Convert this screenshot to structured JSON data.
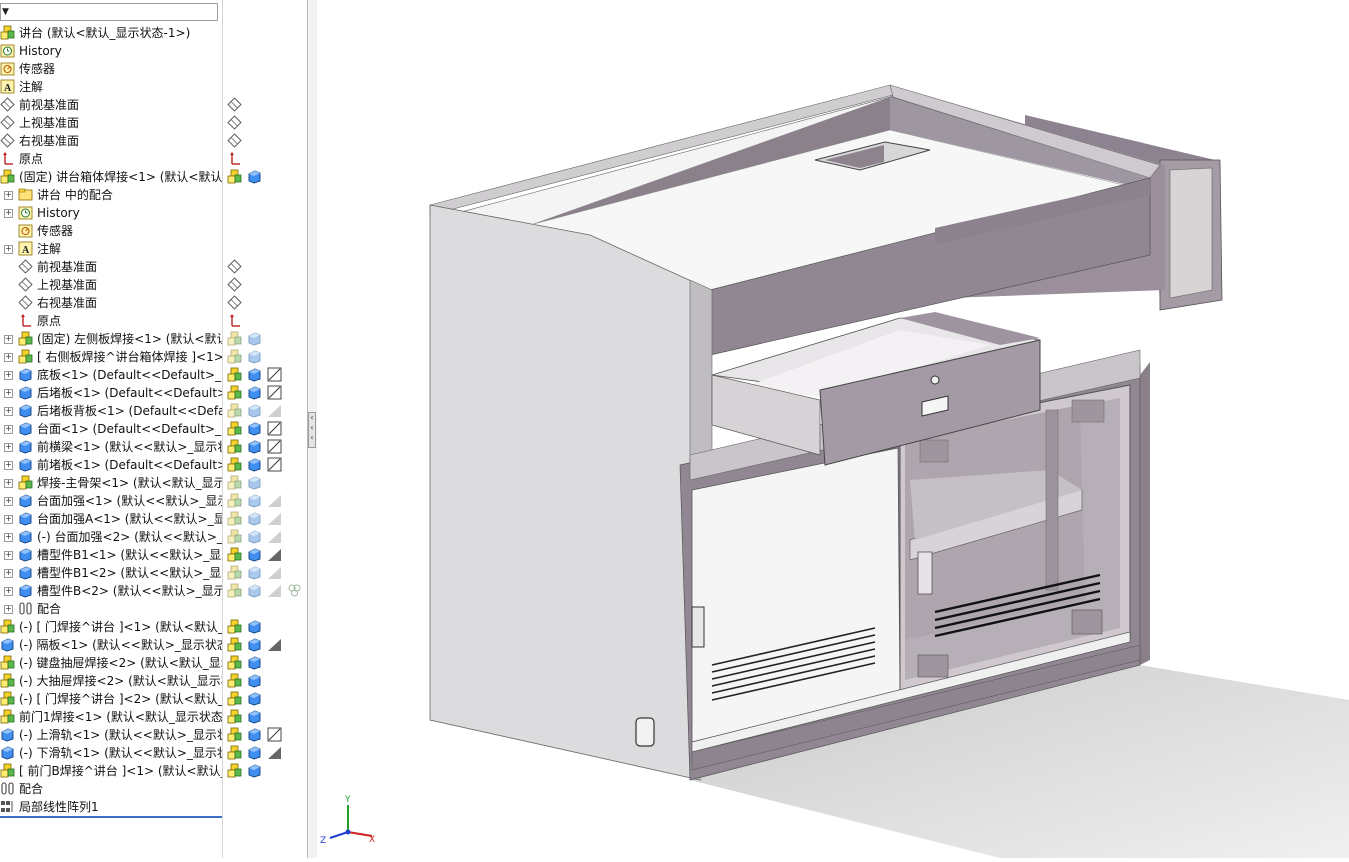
{
  "tree": {
    "rows": [
      {
        "label": "讲台  (默认<默认_显示状态-1>)",
        "indent": 0,
        "icon": "root-assembly-icon",
        "expand": false,
        "status": []
      },
      {
        "label": "History",
        "indent": 0,
        "icon": "history-icon",
        "expand": false,
        "status": []
      },
      {
        "label": "传感器",
        "indent": 0,
        "icon": "sensor-icon",
        "expand": false,
        "status": []
      },
      {
        "label": "注解",
        "indent": 0,
        "icon": "annotation-icon",
        "expand": false,
        "status": []
      },
      {
        "label": "前视基准面",
        "indent": 0,
        "icon": "plane-icon",
        "expand": false,
        "status": [
          "plane-icon"
        ]
      },
      {
        "label": "上视基准面",
        "indent": 0,
        "icon": "plane-icon",
        "expand": false,
        "status": [
          "plane-icon"
        ]
      },
      {
        "label": "右视基准面",
        "indent": 0,
        "icon": "plane-icon",
        "expand": false,
        "status": [
          "plane-icon"
        ]
      },
      {
        "label": "原点",
        "indent": 0,
        "icon": "origin-icon",
        "expand": false,
        "status": [
          "origin-icon"
        ]
      },
      {
        "label": "(固定) 讲台箱体焊接<1> (默认<默认_",
        "indent": 0,
        "icon": "subassembly-icon",
        "expand": false,
        "status": [
          "subassembly-icon",
          "part-icon"
        ]
      },
      {
        "label": "讲台 中的配合",
        "indent": 1,
        "icon": "folder-icon",
        "expand": true,
        "status": []
      },
      {
        "label": "History",
        "indent": 1,
        "icon": "history-icon",
        "expand": true,
        "status": []
      },
      {
        "label": "传感器",
        "indent": 1,
        "icon": "sensor-icon",
        "expand": false,
        "status": []
      },
      {
        "label": "注解",
        "indent": 1,
        "icon": "annotation-icon",
        "expand": true,
        "status": []
      },
      {
        "label": "前视基准面",
        "indent": 1,
        "icon": "plane-icon",
        "expand": false,
        "status": [
          "plane-icon"
        ]
      },
      {
        "label": "上视基准面",
        "indent": 1,
        "icon": "plane-icon",
        "expand": false,
        "status": [
          "plane-icon"
        ]
      },
      {
        "label": "右视基准面",
        "indent": 1,
        "icon": "plane-icon",
        "expand": false,
        "status": [
          "plane-icon"
        ]
      },
      {
        "label": "原点",
        "indent": 1,
        "icon": "origin-icon",
        "expand": false,
        "status": [
          "origin-icon"
        ]
      },
      {
        "label": "(固定) 左侧板焊接<1> (默认<默认",
        "indent": 1,
        "icon": "subassembly-icon",
        "expand": true,
        "status": [
          "subassembly-faded-icon",
          "part-faded-icon"
        ]
      },
      {
        "label": "[ 右侧板焊接^讲台箱体焊接 ]<1>",
        "indent": 1,
        "icon": "subassembly-icon",
        "expand": true,
        "status": [
          "subassembly-faded-icon",
          "part-faded-icon"
        ]
      },
      {
        "label": "底板<1> (Default<<Default>_Ph",
        "indent": 1,
        "icon": "part-icon",
        "expand": true,
        "status": [
          "subassembly-icon",
          "part-icon",
          "drawing-icon"
        ]
      },
      {
        "label": "后堵板<1> (Default<<Default>_",
        "indent": 1,
        "icon": "part-icon",
        "expand": true,
        "status": [
          "subassembly-icon",
          "part-icon",
          "drawing-icon"
        ]
      },
      {
        "label": "后堵板背板<1> (Default<<Defau",
        "indent": 1,
        "icon": "part-icon",
        "expand": true,
        "status": [
          "subassembly-faded-icon",
          "part-faded-icon",
          "sheet-faded-icon"
        ]
      },
      {
        "label": "台面<1> (Default<<Default>_Ph",
        "indent": 1,
        "icon": "part-icon",
        "expand": true,
        "status": [
          "subassembly-icon",
          "part-icon",
          "drawing-icon"
        ]
      },
      {
        "label": "前横梁<1> (默认<<默认>_显示状",
        "indent": 1,
        "icon": "part-icon",
        "expand": true,
        "status": [
          "subassembly-icon",
          "part-icon",
          "drawing-icon"
        ]
      },
      {
        "label": "前堵板<1> (Default<<Default>_",
        "indent": 1,
        "icon": "part-icon",
        "expand": true,
        "status": [
          "subassembly-icon",
          "part-icon",
          "drawing-icon"
        ]
      },
      {
        "label": "焊接-主骨架<1> (默认<默认_显示",
        "indent": 1,
        "icon": "subassembly-icon",
        "expand": true,
        "status": [
          "subassembly-faded-icon",
          "part-faded-icon"
        ]
      },
      {
        "label": "台面加强<1> (默认<<默认>_显示",
        "indent": 1,
        "icon": "part-icon",
        "expand": true,
        "status": [
          "subassembly-faded-icon",
          "part-faded-icon",
          "sheet-faded-icon"
        ]
      },
      {
        "label": "台面加强A<1> (默认<<默认>_显",
        "indent": 1,
        "icon": "part-icon",
        "expand": true,
        "status": [
          "subassembly-faded-icon",
          "part-faded-icon",
          "sheet-faded-icon"
        ]
      },
      {
        "label": "(-) 台面加强<2> (默认<<默认>_显",
        "indent": 1,
        "icon": "part-icon",
        "expand": true,
        "status": [
          "subassembly-faded-icon",
          "part-faded-icon",
          "sheet-faded-icon"
        ]
      },
      {
        "label": "槽型件B1<1> (默认<<默认>_显示",
        "indent": 1,
        "icon": "part-icon",
        "expand": true,
        "status": [
          "subassembly-icon",
          "part-icon",
          "sheet-icon"
        ]
      },
      {
        "label": "槽型件B1<2> (默认<<默认>_显示",
        "indent": 1,
        "icon": "part-icon",
        "expand": true,
        "status": [
          "subassembly-faded-icon",
          "part-faded-icon",
          "sheet-faded-icon"
        ]
      },
      {
        "label": "槽型件B<2> (默认<<默认>_显示",
        "indent": 1,
        "icon": "part-icon",
        "expand": true,
        "status": [
          "subassembly-faded-icon",
          "part-faded-icon",
          "sheet-faded-icon",
          "pattern-faded-icon"
        ]
      },
      {
        "label": "配合",
        "indent": 1,
        "icon": "mates-icon",
        "expand": true,
        "status": []
      },
      {
        "label": "(-) [ 门焊接^讲台 ]<1> (默认<默认_显",
        "indent": 0,
        "icon": "subassembly-icon",
        "expand": false,
        "status": [
          "subassembly-icon",
          "part-icon"
        ]
      },
      {
        "label": "(-) 隔板<1> (默认<<默认>_显示状态",
        "indent": 0,
        "icon": "part-icon",
        "expand": false,
        "status": [
          "subassembly-icon",
          "part-icon",
          "sheet-icon"
        ]
      },
      {
        "label": "(-) 键盘抽屉焊接<2> (默认<默认_显示",
        "indent": 0,
        "icon": "subassembly-icon",
        "expand": false,
        "status": [
          "subassembly-icon",
          "part-icon"
        ]
      },
      {
        "label": "(-) 大抽屉焊接<2> (默认<默认_显示状",
        "indent": 0,
        "icon": "subassembly-icon",
        "expand": false,
        "status": [
          "subassembly-icon",
          "part-icon"
        ]
      },
      {
        "label": "(-) [ 门焊接^讲台 ]<2> (默认<默认_显",
        "indent": 0,
        "icon": "subassembly-icon",
        "expand": false,
        "status": [
          "subassembly-icon",
          "part-icon"
        ]
      },
      {
        "label": "前门1焊接<1> (默认<默认_显示状态-",
        "indent": 0,
        "icon": "subassembly-icon",
        "expand": false,
        "status": [
          "subassembly-icon",
          "part-icon"
        ]
      },
      {
        "label": "(-) 上滑轨<1> (默认<<默认>_显示状",
        "indent": 0,
        "icon": "part-icon",
        "expand": false,
        "status": [
          "subassembly-icon",
          "part-icon",
          "drawing-icon"
        ]
      },
      {
        "label": "(-) 下滑轨<1> (默认<<默认>_显示状",
        "indent": 0,
        "icon": "part-icon",
        "expand": false,
        "status": [
          "subassembly-icon",
          "part-icon",
          "sheet-icon"
        ]
      },
      {
        "label": "[ 前门B焊接^讲台 ]<1> (默认<默认_显",
        "indent": 0,
        "icon": "subassembly-icon",
        "expand": false,
        "status": [
          "subassembly-icon",
          "part-icon"
        ]
      },
      {
        "label": "配合",
        "indent": 0,
        "icon": "mates-icon",
        "expand": false,
        "status": []
      },
      {
        "label": "局部线性阵列1",
        "indent": 0,
        "icon": "pattern-icon",
        "expand": false,
        "status": []
      }
    ]
  },
  "viewport": {
    "triad": {
      "x": "X",
      "y": "Y",
      "z": "Z"
    }
  }
}
